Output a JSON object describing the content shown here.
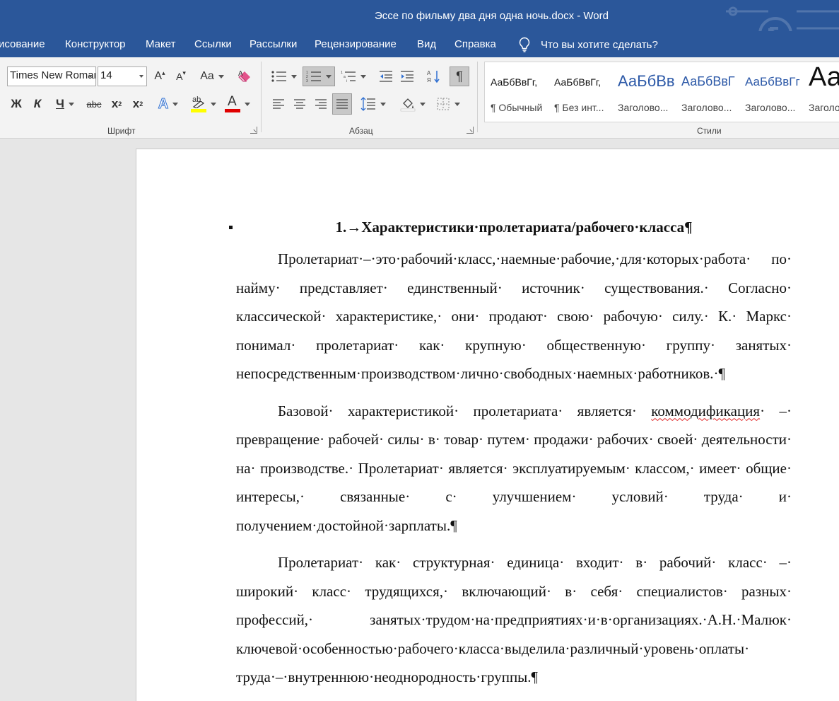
{
  "window": {
    "title": "Эссе по фильму два дня одна ночь.docx  -  Word"
  },
  "tabs": [
    {
      "label": "исование"
    },
    {
      "label": "Конструктор"
    },
    {
      "label": "Макет"
    },
    {
      "label": "Ссылки"
    },
    {
      "label": "Рассылки"
    },
    {
      "label": "Рецензирование"
    },
    {
      "label": "Вид"
    },
    {
      "label": "Справка"
    }
  ],
  "tell_me": {
    "placeholder": "Что вы хотите сделать?"
  },
  "font": {
    "name": "Times New Roman",
    "size": "14",
    "grow_label": "A",
    "shrink_label": "A",
    "case_label": "Aa",
    "bold": "Ж",
    "italic": "К",
    "underline": "Ч",
    "strike": "abc",
    "subscript_base": "x",
    "subscript_mark": "2",
    "superscript_base": "x",
    "superscript_mark": "2",
    "text_effects": "A",
    "highlight": "ab",
    "font_color": "A",
    "highlight_color": "#ffff00",
    "font_color_value": "#e00000",
    "group_label": "Шрифт"
  },
  "paragraph": {
    "group_label": "Абзац"
  },
  "styles": {
    "group_label": "Стили",
    "items": [
      {
        "preview": "АаБбВвГг,",
        "name": "¶ Обычный"
      },
      {
        "preview": "АаБбВвГг,",
        "name": "¶ Без инт..."
      },
      {
        "preview": "АаБбВв",
        "name": "Заголово..."
      },
      {
        "preview": "АаБбВвГ",
        "name": "Заголово..."
      },
      {
        "preview": "АаБбВвГг",
        "name": "Заголово..."
      },
      {
        "preview": "Аа",
        "name": "Заголо"
      }
    ]
  },
  "document": {
    "heading": "1.→Характеристики·пролетариата/рабочего·класса¶",
    "paragraphs": [
      {
        "text": "Пролетариат·–·это·рабочий·класс,·наемные·рабочие,·для·которых·работа· по· найму· представляет· единственный· источник· существования.· Согласно· классической· характеристике,· они· продают· свою· рабочую· силу.· К.· Маркс· понимал· пролетариат· как· крупную· общественную· группу· занятых· непосредственным·производством·лично·свободных·наемных·работников.·¶"
      },
      {
        "before": "Базовой· характеристикой· пролетариата· является· ",
        "flagged": "коммодификация",
        "after": "· –· превращение· рабочей· силы· в· товар· путем· продажи· рабочих· своей· деятельности· на· производстве.· Пролетариат· является· эксплуатируемым· классом,· имеет· общие· интересы,· связанные· с· улучшением· условий· труда· и· получением·достойной·зарплаты.¶"
      },
      {
        "text": "Пролетариат· как· структурная· единица· входит· в· рабочий· класс· –· широкий· класс· трудящихся,· включающий· в· себя· специалистов· разных· профессий,· занятых·трудом·на·предприятиях·и·в·организациях.·А.Н.·Малюк· ключевой·особенностью·рабочего·класса·выделила·различный·уровень·оплаты· труда·–·внутреннюю·неоднородность·группы.¶"
      }
    ]
  }
}
